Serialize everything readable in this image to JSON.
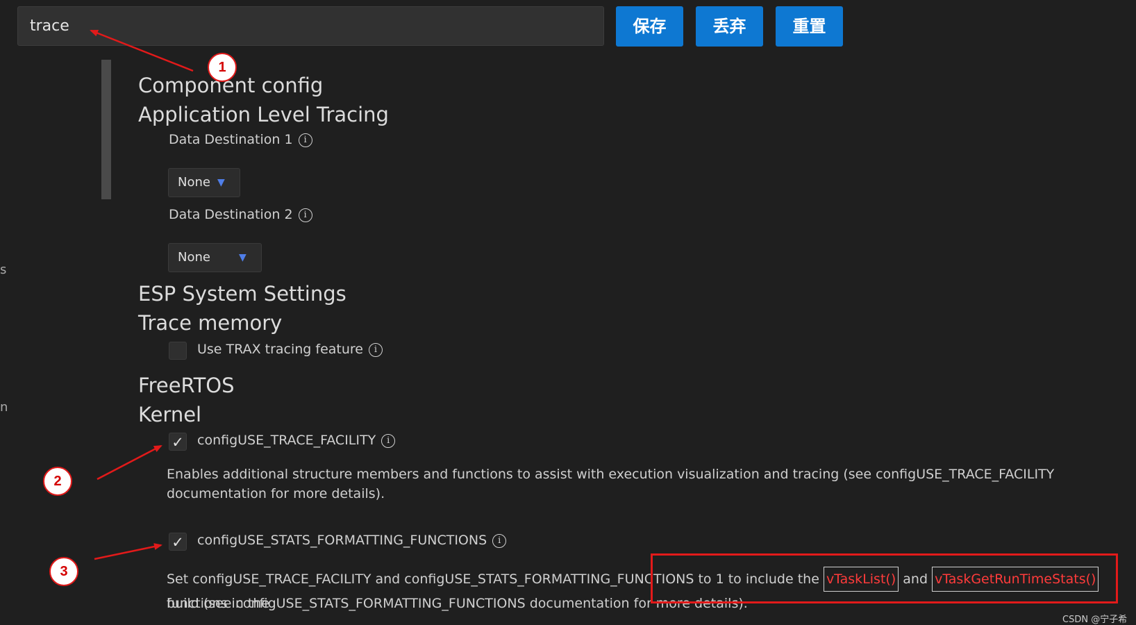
{
  "search": {
    "value": "trace"
  },
  "toolbar": {
    "save_label": "保存",
    "discard_label": "丢弃",
    "reset_label": "重置"
  },
  "sections": {
    "component_config": "Component config",
    "app_level_tracing": "Application Level Tracing",
    "data_dest_1_label": "Data Destination 1",
    "data_dest_1_value": "None",
    "data_dest_2_label": "Data Destination 2",
    "data_dest_2_value": "None",
    "esp_system_settings": "ESP System Settings",
    "trace_memory": "Trace memory",
    "use_trax_label": "Use TRAX tracing feature",
    "freertos": "FreeRTOS",
    "kernel": "Kernel",
    "trace_facility_label": "configUSE_TRACE_FACILITY",
    "trace_facility_desc": "Enables additional structure members and functions to assist with execution visualization and tracing (see configUSE_TRACE_FACILITY documentation for more details).",
    "stats_fmt_label": "configUSE_STATS_FORMATTING_FUNCTIONS",
    "stats_desc_part1": "Set configUSE_TRACE_FACILITY and configUSE_STATS_FORMATTING_FUNCTIONS to 1 to include the",
    "fn_vtasklist": "vTaskList()",
    "and_text": "and",
    "fn_vtaskgetruntimestats": "vTaskGetRunTimeStats()",
    "stats_desc_part2": "functions in the",
    "stats_desc_part3": "build (see configUSE_STATS_FORMATTING_FUNCTIONS documentation for more details)."
  },
  "checkboxes": {
    "use_trax": false,
    "trace_facility": true,
    "stats_formatting": true
  },
  "icons": {
    "info": "info-icon",
    "chevron": "chevron-down-icon",
    "check": "check-icon"
  },
  "annotations": {
    "callout_1": "1",
    "callout_2": "2",
    "callout_3": "3",
    "color": "#e21a1a"
  },
  "watermark": "CSDN @宁子希",
  "edge_fragments": {
    "s": "s",
    "n": "n"
  }
}
